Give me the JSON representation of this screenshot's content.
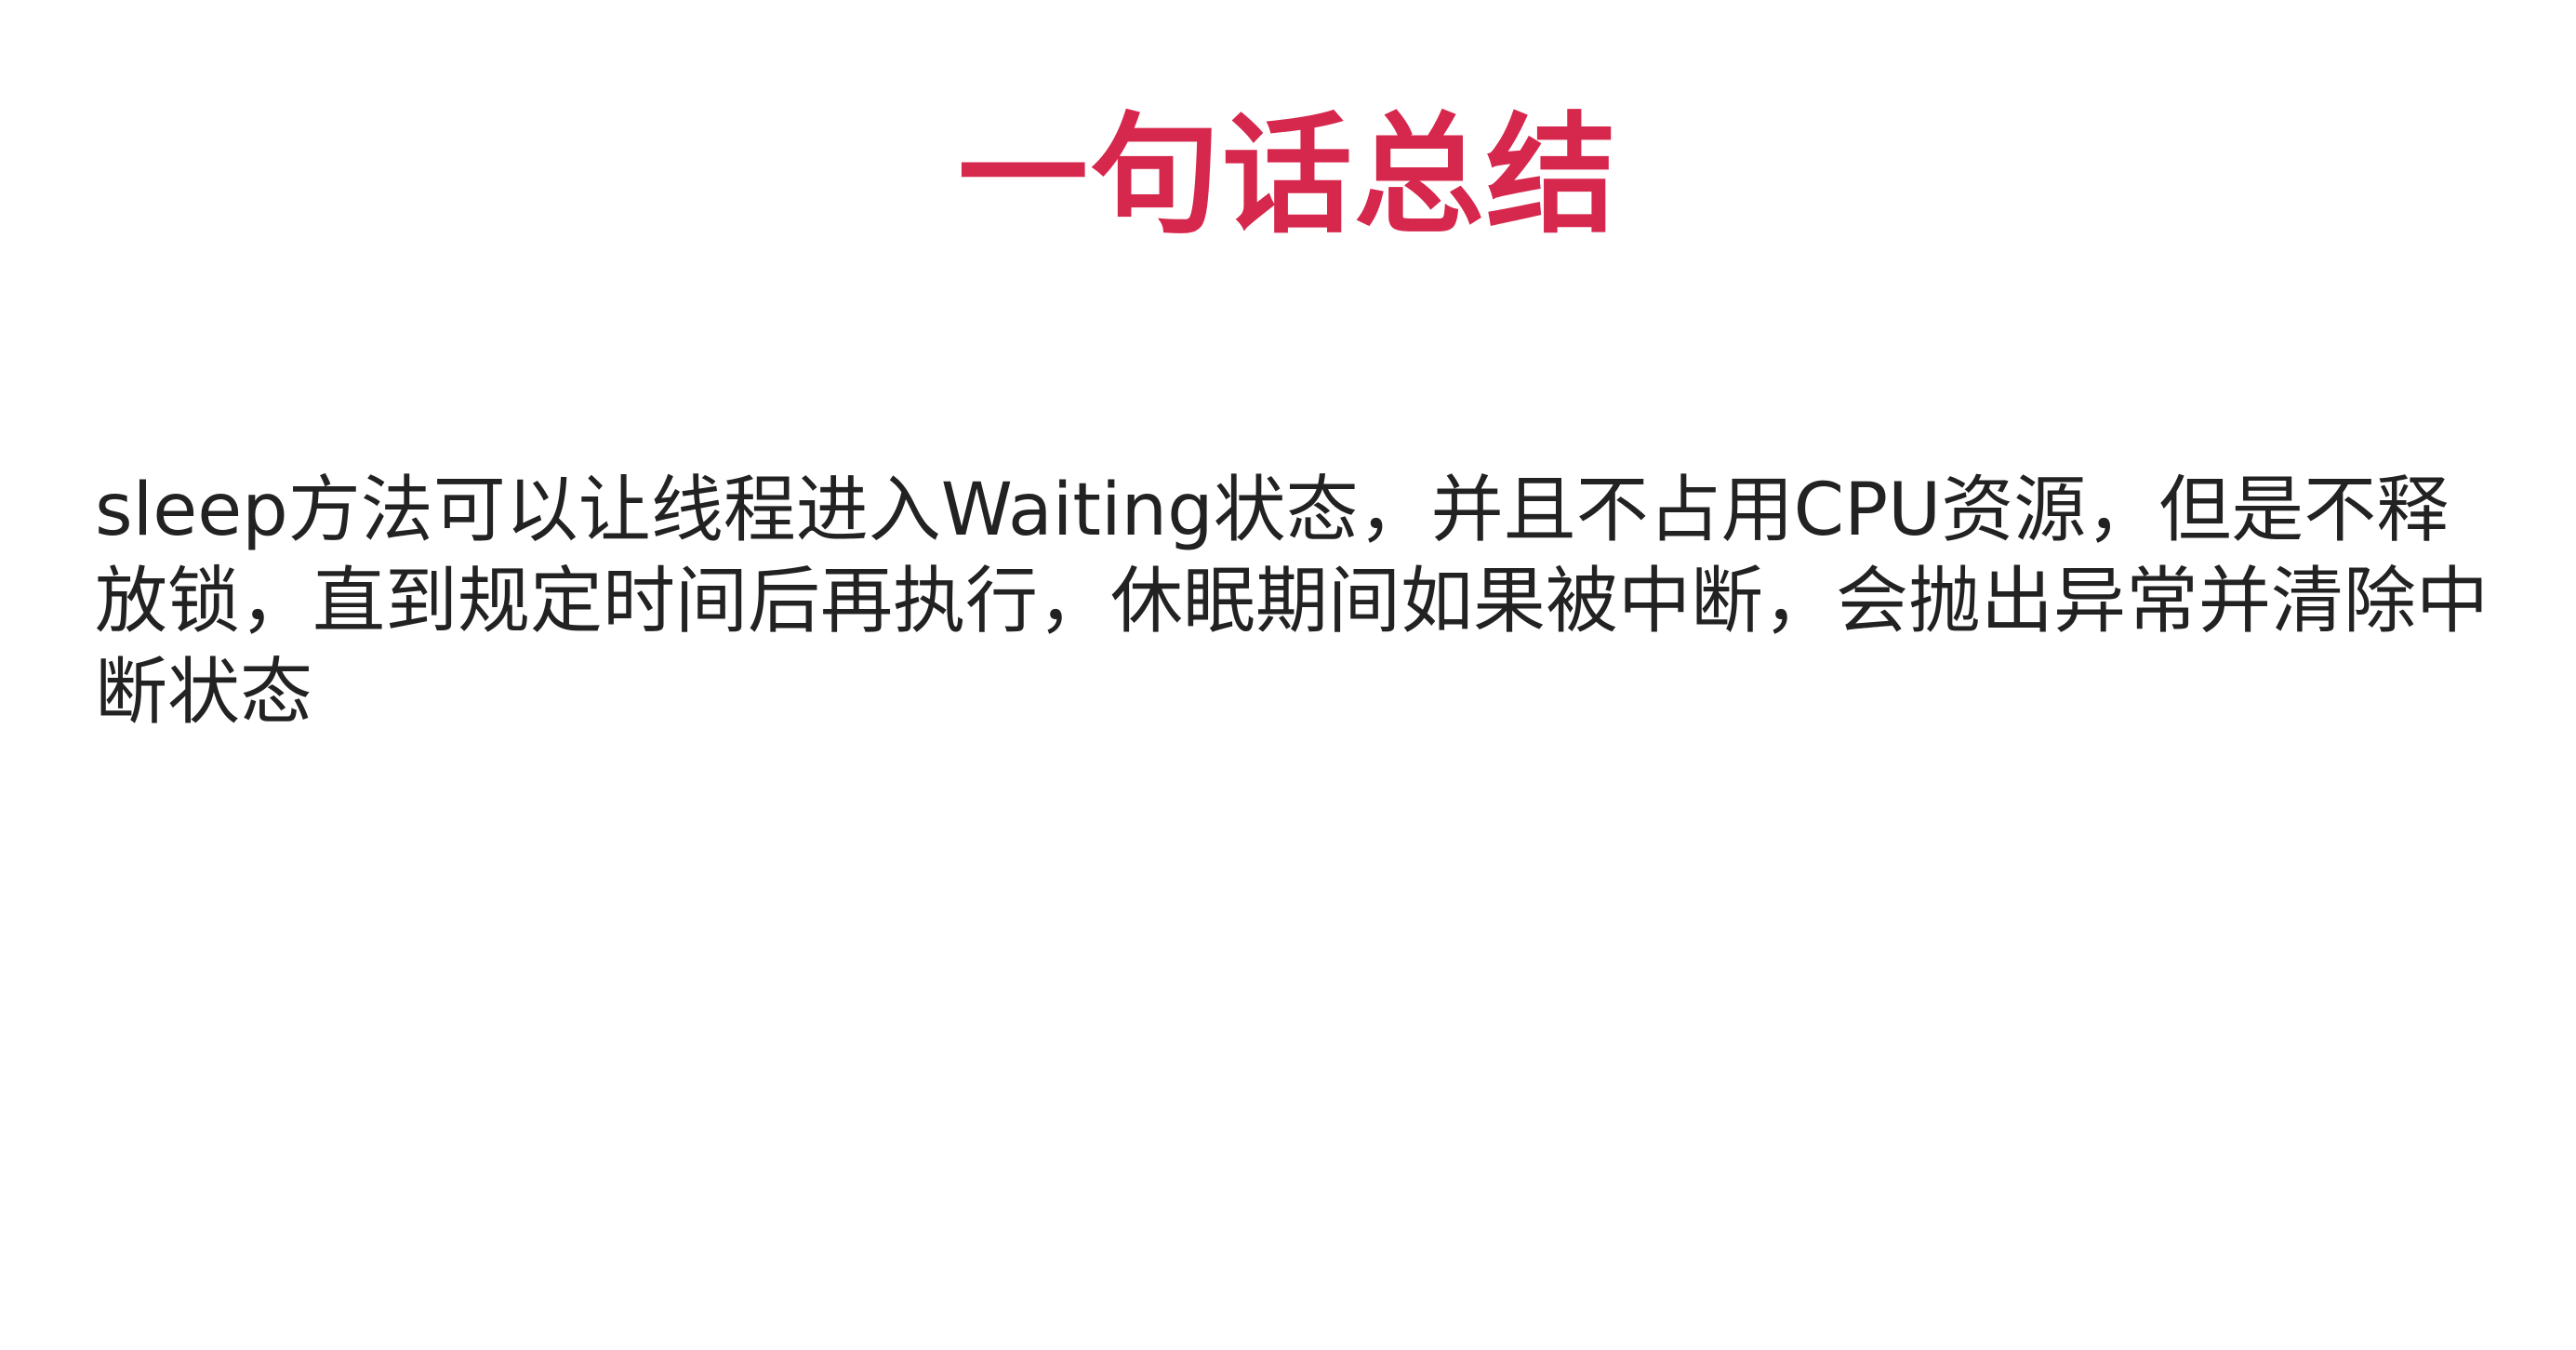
{
  "slide": {
    "title": "一句话总结",
    "body": "sleep方法可以让线程进入Waiting状态，并且不占用CPU资源，但是不释放锁，直到规定时间后再执行，休眠期间如果被中断，会抛出异常并清除中断状态"
  },
  "colors": {
    "title": "#d6274d",
    "body_text": "#222222",
    "background": "#ffffff"
  }
}
